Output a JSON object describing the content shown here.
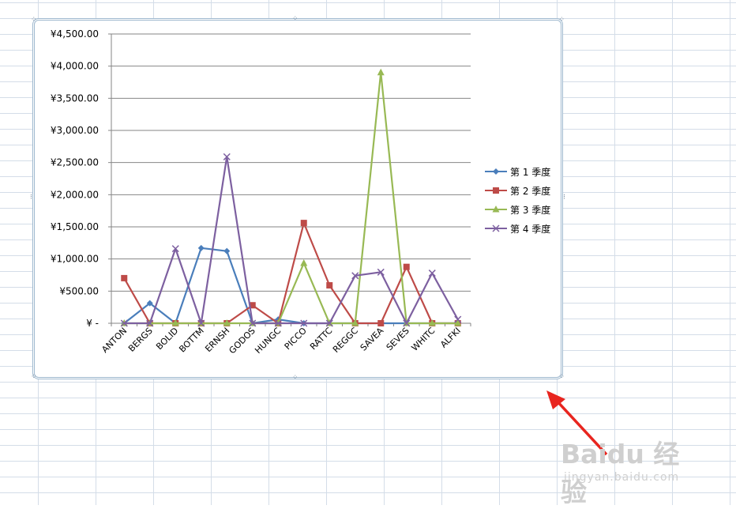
{
  "chart_data": {
    "type": "line",
    "categories": [
      "ANTON",
      "BERGS",
      "BOLID",
      "BOTTM",
      "ERNSH",
      "GODOS",
      "HUNGC",
      "PICCO",
      "RATTC",
      "REGGC",
      "SAVEA",
      "SEVES",
      "WHITC",
      "ALFKI"
    ],
    "series": [
      {
        "name": "第 1 季度",
        "color": "#4a7ebb",
        "marker": "diamond",
        "values": [
          0,
          312,
          0,
          1170,
          1123,
          0,
          60,
          0,
          0,
          0,
          0,
          0,
          0,
          0
        ]
      },
      {
        "name": "第 2 季度",
        "color": "#be4b48",
        "marker": "square",
        "values": [
          702,
          0,
          0,
          0,
          0,
          280,
          0,
          1560,
          590,
          0,
          0,
          877,
          0,
          0
        ]
      },
      {
        "name": "第 3 季度",
        "color": "#98b954",
        "marker": "triangle",
        "values": [
          0,
          0,
          0,
          0,
          0,
          0,
          0,
          935,
          0,
          0,
          3900,
          0,
          0,
          0
        ]
      },
      {
        "name": "第 4 季度",
        "color": "#7d60a0",
        "marker": "x",
        "values": [
          0,
          0,
          1160,
          0,
          2590,
          0,
          0,
          0,
          0,
          740,
          795,
          0,
          780,
          60
        ]
      }
    ],
    "y_ticks": [
      "¥ -",
      "¥500.00",
      "¥1,000.00",
      "¥1,500.00",
      "¥2,000.00",
      "¥2,500.00",
      "¥3,000.00",
      "¥3,500.00",
      "¥4,000.00",
      "¥4,500.00"
    ],
    "ylim": [
      0,
      4500
    ],
    "grid": true,
    "legend_position": "right"
  },
  "watermark": {
    "main": "Baidu 经验",
    "sub": "jingyan.baidu.com"
  },
  "colors": {
    "arrow": "#e8251f",
    "frame": "#9fb9cf",
    "gridline": "#868686"
  }
}
